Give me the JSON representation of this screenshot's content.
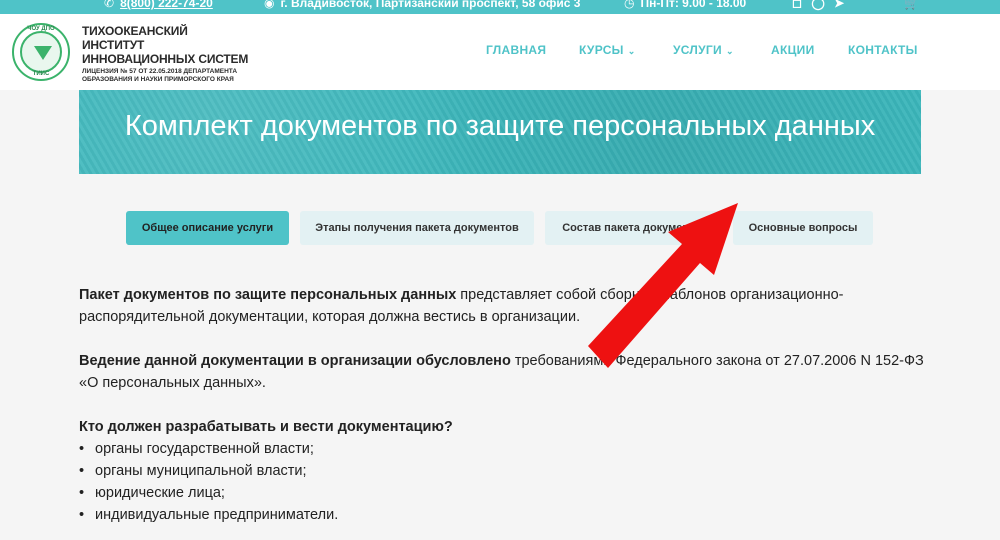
{
  "topbar": {
    "phone": "8(800) 222-74-20",
    "address": "г. Владивосток, Партизанский проспект, 58 офис 3",
    "hours": "Пн-Пт: 9.00 - 18.00"
  },
  "logo": {
    "emblem_top": "ЧОУ ДПО",
    "emblem_bottom": "ТИИС",
    "line1": "ТИХООКЕАНСКИЙ ИНСТИТУТ",
    "line2": "ИННОВАЦИОННЫХ СИСТЕМ",
    "license": "ЛИЦЕНЗИЯ № 57 ОТ 22.05.2018 ДЕПАРТАМЕНТА ОБРАЗОВАНИЯ И НАУКИ ПРИМОРСКОГО КРАЯ"
  },
  "nav": {
    "items": [
      "ГЛАВНАЯ",
      "КУРСЫ",
      "УСЛУГИ",
      "АКЦИИ",
      "КОНТАКТЫ"
    ]
  },
  "banner": {
    "title": "Комплект документов по защите персональных данных"
  },
  "tabs": [
    "Общее описание услуги",
    "Этапы получения пакета документов",
    "Состав пакета документов",
    "Основные вопросы"
  ],
  "content": {
    "p1_bold": "Пакет документов по защите персональных данных",
    "p1_text": " представляет собой сборник шаблонов организационно-распорядительной документации, которая должна вестись в организации.",
    "p2_bold": "Ведение данной документации в организации обусловлено",
    "p2_text": "  требованиями Федерального закона от 27.07.2006 N 152-ФЗ «О персональных данных».",
    "q_heading": "Кто должен разрабатывать и вести документацию?",
    "list": [
      "органы государственной власти;",
      "органы муниципальной власти;",
      "юридические  лица;",
      "индивидуальные предприниматели."
    ]
  },
  "colors": {
    "accent": "#4fc3c8",
    "banner": "#3bb6bb",
    "arrow": "#ee1111"
  }
}
